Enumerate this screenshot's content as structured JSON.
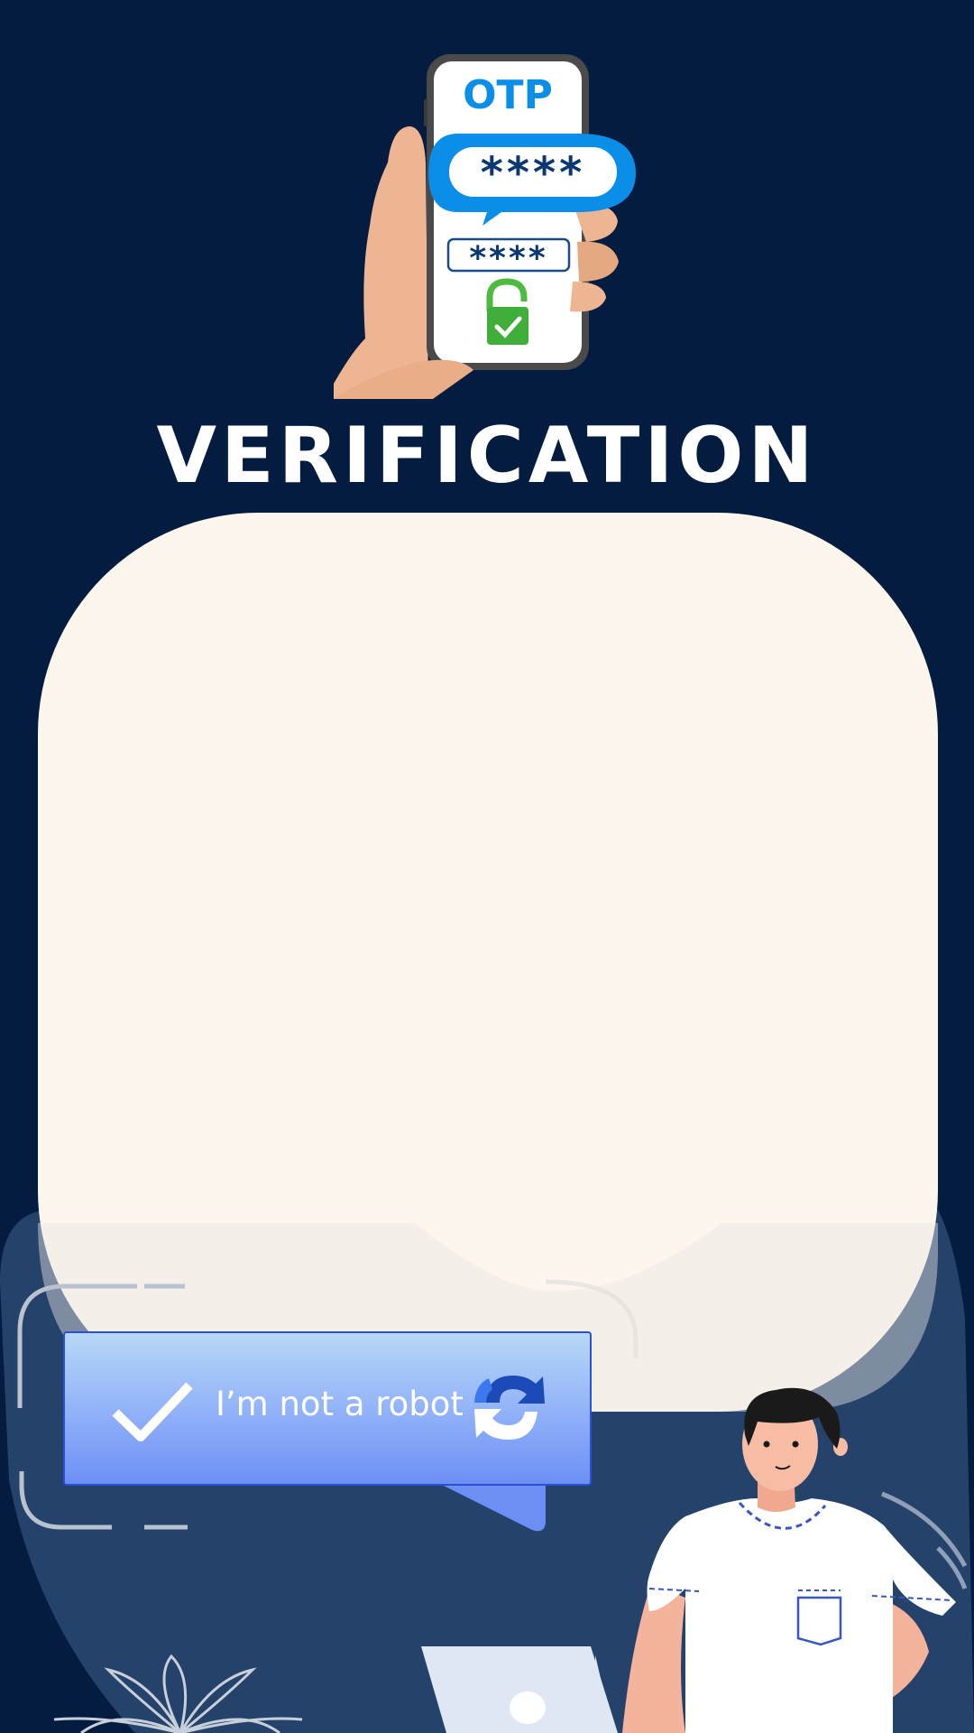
{
  "otp": {
    "label": "OTP",
    "bubble_code": "****",
    "field_code": "****"
  },
  "title": "VERIFICATION",
  "captcha": {
    "label": "I’m not a robot"
  },
  "icons": {
    "check": "checkmark-icon",
    "recaptcha": "recaptcha-icon",
    "lock": "unlocked-padlock-icon"
  },
  "colors": {
    "background": "#041c40",
    "card": "#fdf6ec",
    "otp_blue": "#0a8ee8",
    "captcha_blue": "#6d8ff5",
    "lock_green": "#3fae3a"
  }
}
